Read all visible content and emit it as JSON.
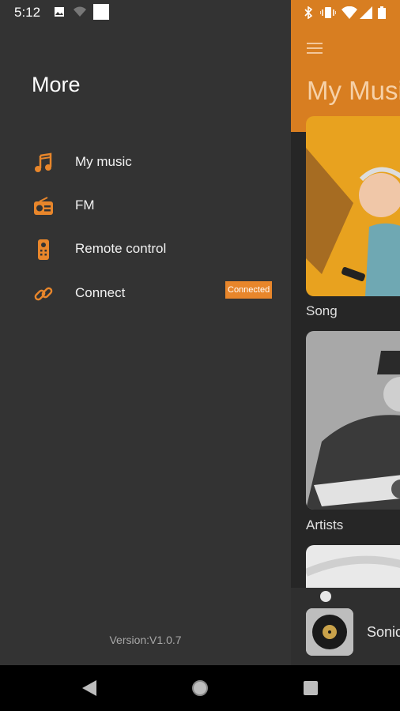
{
  "status_bar": {
    "time": "5:12"
  },
  "drawer": {
    "title": "More",
    "items": [
      {
        "label": "My music",
        "icon": "music-note-icon"
      },
      {
        "label": "FM",
        "icon": "radio-icon"
      },
      {
        "label": "Remote control",
        "icon": "remote-control-icon"
      },
      {
        "label": "Connect",
        "icon": "link-icon",
        "badge": "Connected"
      }
    ],
    "version": "Version:V1.0.7"
  },
  "main": {
    "title": "My Musi",
    "cards": [
      {
        "label": "Song"
      },
      {
        "label": "Artists"
      }
    ],
    "player": {
      "title": "Sonic"
    }
  },
  "colors": {
    "accent": "#d87e21",
    "drawer_bg": "#333333",
    "badge": "#e8862b"
  }
}
